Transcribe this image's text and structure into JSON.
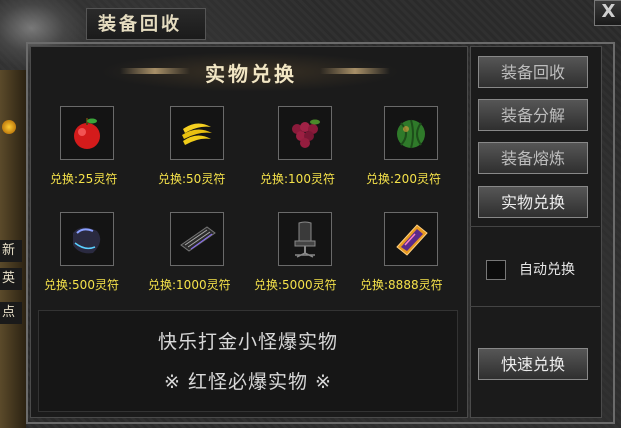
{
  "window": {
    "title": "装备回收",
    "close_label": "X"
  },
  "left_fragments": [
    "新",
    "英",
    "点"
  ],
  "panel": {
    "section_title": "实物兑换"
  },
  "items": [
    {
      "name": "apple",
      "price": "兑换:25灵符"
    },
    {
      "name": "bananas",
      "price": "兑换:50灵符"
    },
    {
      "name": "grapes",
      "price": "兑换:100灵符"
    },
    {
      "name": "watermelon",
      "price": "兑换:200灵符"
    },
    {
      "name": "gaming-mouse",
      "price": "兑换:500灵符"
    },
    {
      "name": "mechanical-keyboard",
      "price": "兑换:1000灵符"
    },
    {
      "name": "gaming-chair",
      "price": "兑换:5000灵符"
    },
    {
      "name": "smartphone",
      "price": "兑换:8888灵符"
    }
  ],
  "promo": {
    "line1": "快乐打金小怪爆实物",
    "line2": "※ 红怪必爆实物 ※"
  },
  "sidebar": {
    "buttons": [
      {
        "label": "装备回收"
      },
      {
        "label": "装备分解"
      },
      {
        "label": "装备熔炼"
      },
      {
        "label": "实物兑换"
      }
    ],
    "auto_exchange_label": "自动兑换",
    "quick_exchange_label": "快速兑换"
  },
  "colors": {
    "price_text": "#f5e24a",
    "panel_bg": "#1b1b1b"
  }
}
